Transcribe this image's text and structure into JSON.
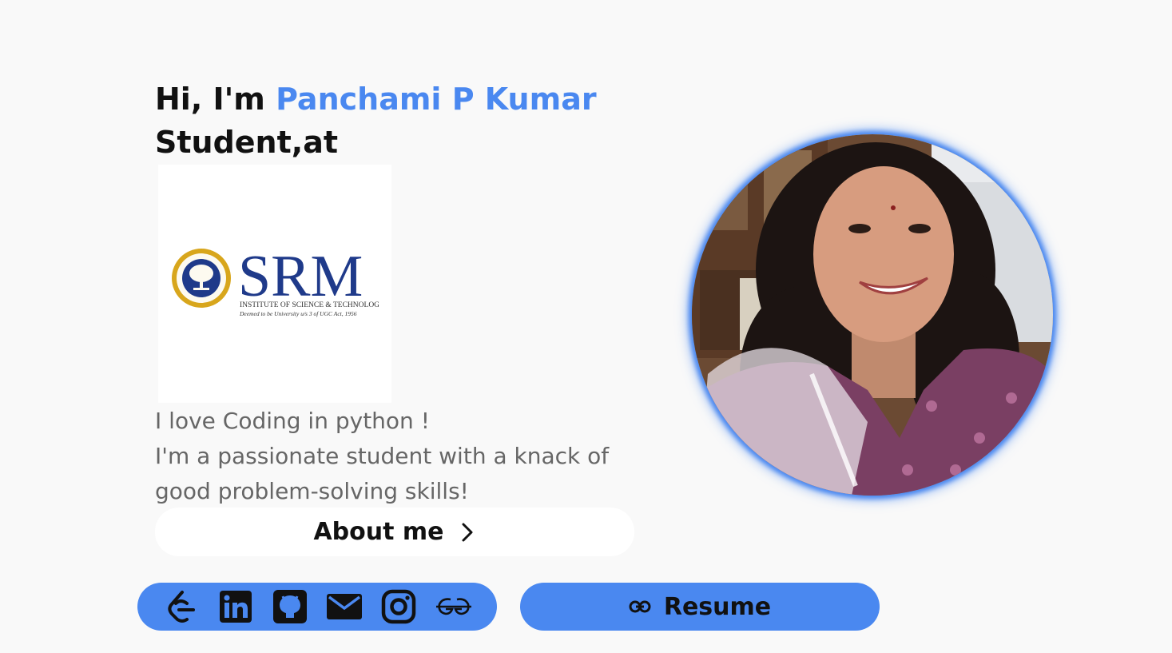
{
  "hero": {
    "greeting_prefix": "Hi, I'm ",
    "name": "Panchami P Kumar",
    "role": "Student,at"
  },
  "institution_logo": {
    "wordmark": "SRM",
    "line1": "INSTITUTE OF SCIENCE & TECHNOLOGY",
    "line2": "Deemed to be University u/s 3 of UGC Act, 1956"
  },
  "bio": {
    "line1": "I love Coding in python !",
    "line2": "I'm a passionate student with a knack of",
    "line3": "good problem-solving skills!"
  },
  "about_button": {
    "label": "About me",
    "icon": "chevron-right-icon"
  },
  "social_links": [
    {
      "name": "leetcode",
      "icon": "leetcode-icon"
    },
    {
      "name": "linkedin",
      "icon": "linkedin-icon"
    },
    {
      "name": "github",
      "icon": "github-icon"
    },
    {
      "name": "email",
      "icon": "mail-icon"
    },
    {
      "name": "instagram",
      "icon": "instagram-icon"
    },
    {
      "name": "geeksforgeeks",
      "icon": "geeksforgeeks-icon"
    }
  ],
  "resume_button": {
    "label": "Resume",
    "icon": "link-icon"
  },
  "colors": {
    "accent": "#4a88f0",
    "background": "#f9f9f9",
    "text": "#111111",
    "muted_text": "#666666",
    "logo_blue": "#1f3a8a"
  }
}
